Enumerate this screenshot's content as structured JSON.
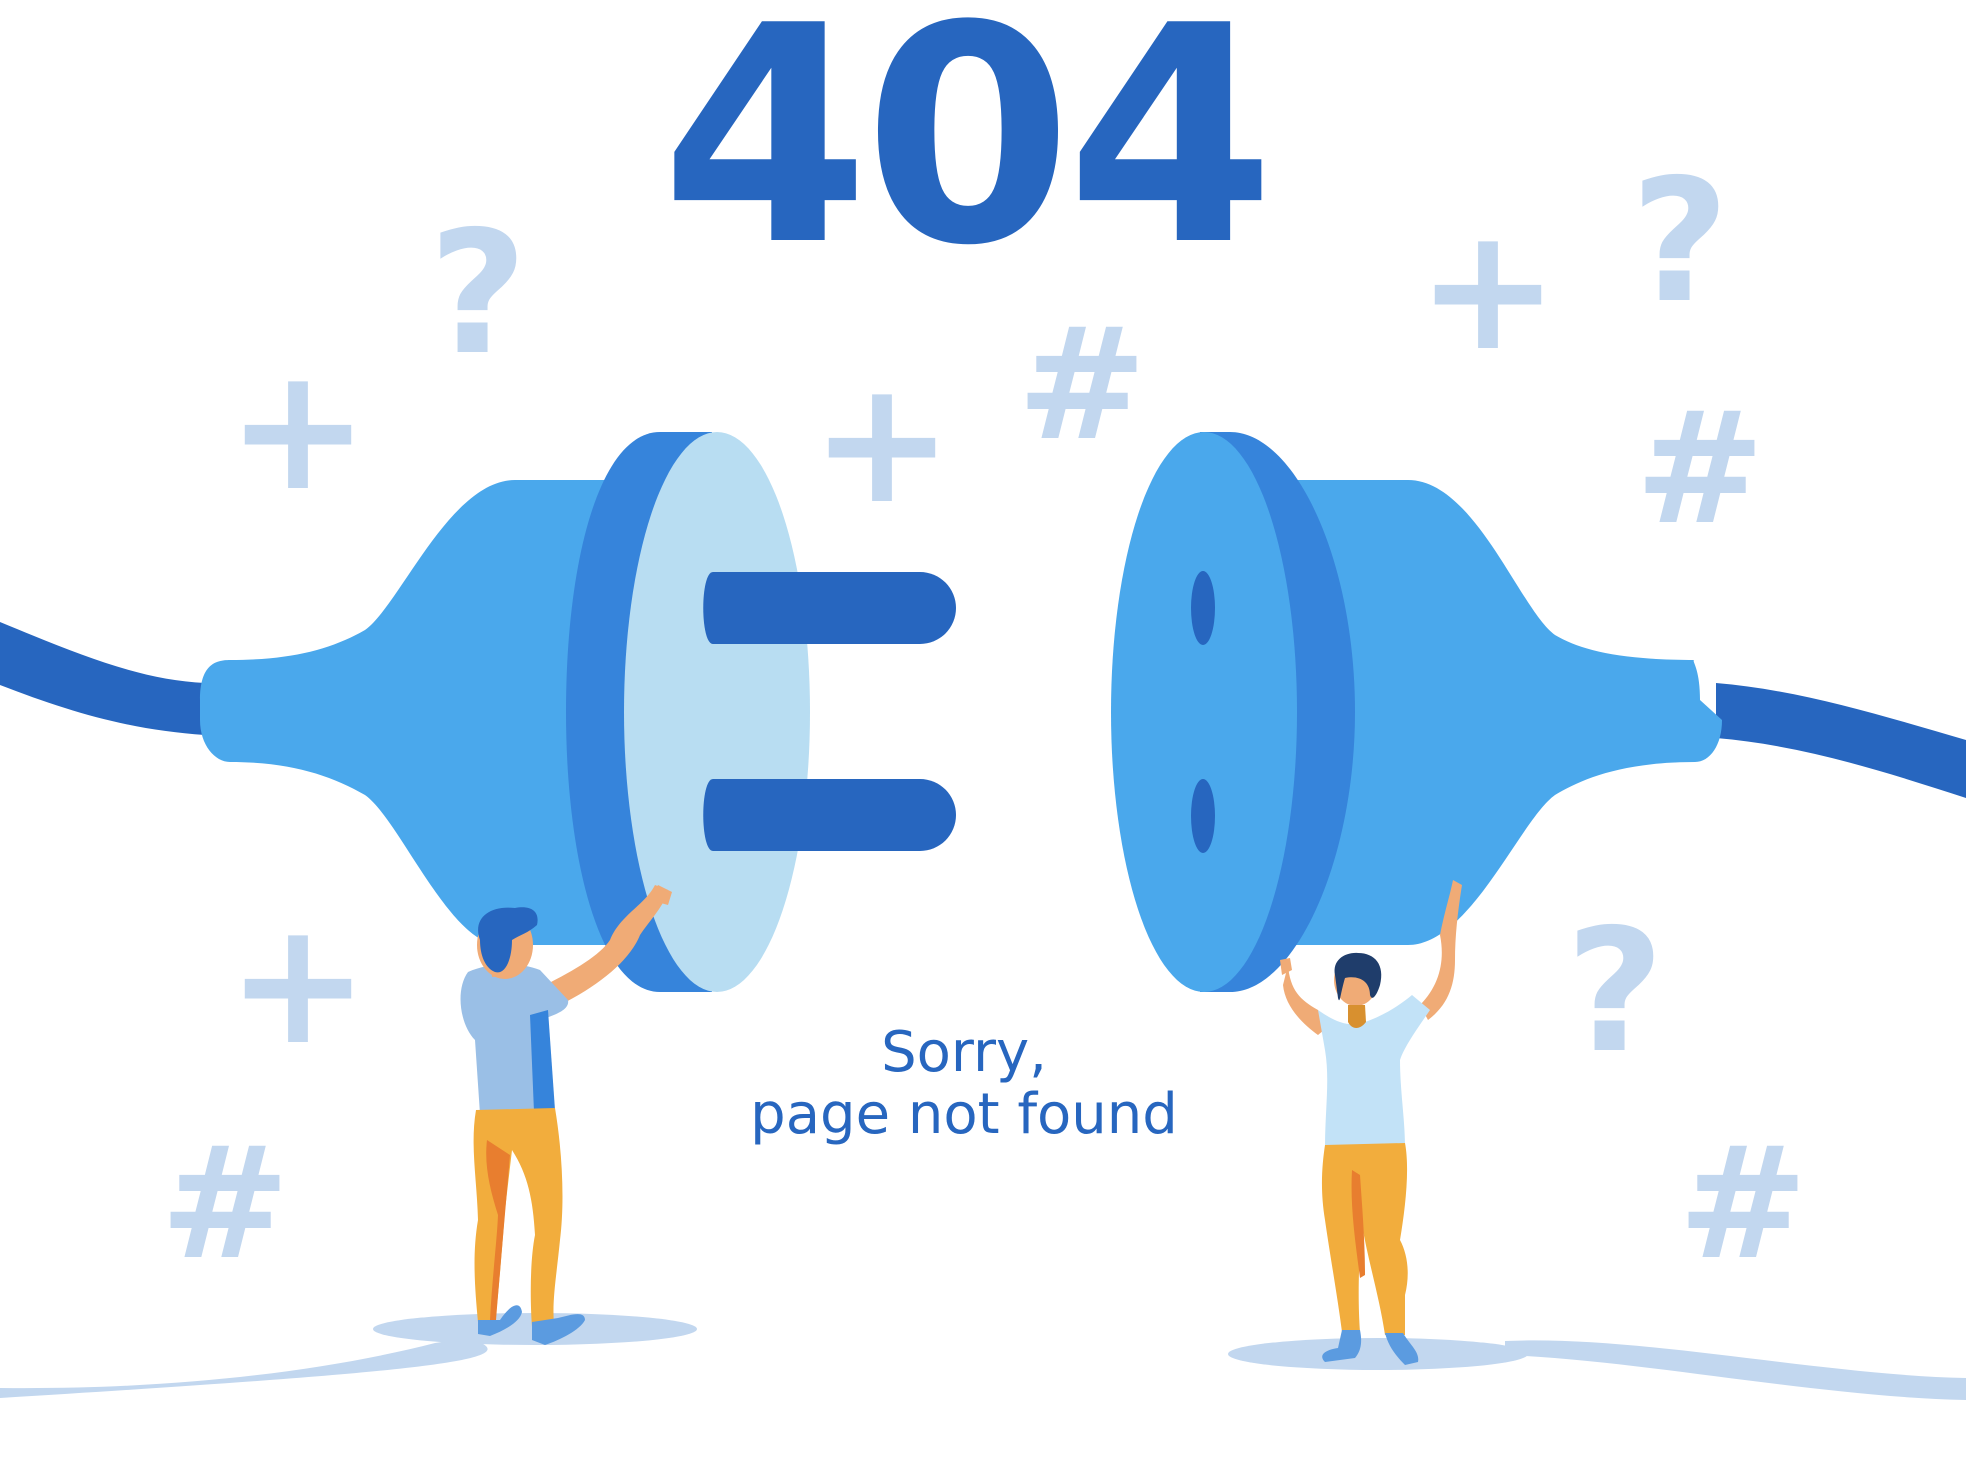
{
  "error": {
    "code": "404",
    "message_line1": "Sorry,",
    "message_line2": "page not found"
  },
  "decorations": {
    "question_glyph": "?",
    "plus_glyph": "+",
    "hash_glyph": "#"
  },
  "colors": {
    "primary": "#2766bf",
    "plug_light": "#4aa8ec",
    "plug_mid": "#3684db",
    "plug_face": "#b8ddf2",
    "decor": "#c2d7ef",
    "pants": "#f2ad3d",
    "skin": "#f0ab76"
  }
}
